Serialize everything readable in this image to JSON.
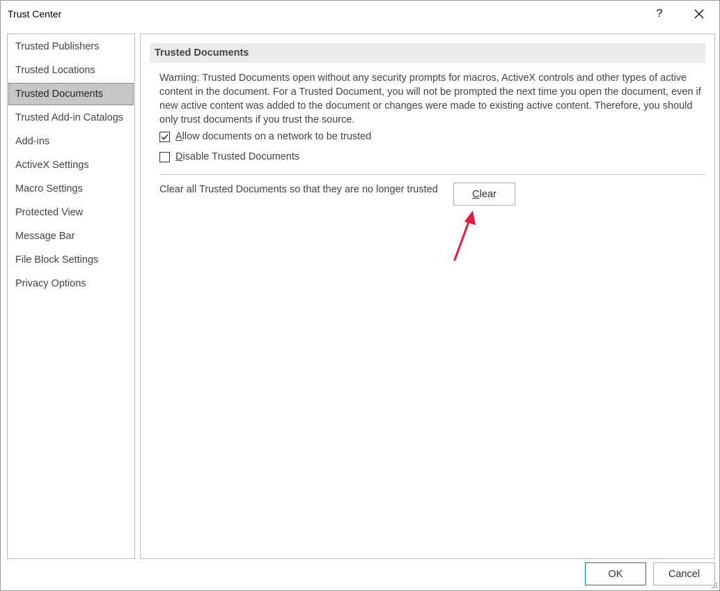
{
  "window": {
    "title": "Trust Center",
    "help_label": "?",
    "close_icon": "close-icon"
  },
  "sidebar": {
    "items": [
      {
        "label": "Trusted Publishers",
        "selected": false
      },
      {
        "label": "Trusted Locations",
        "selected": false
      },
      {
        "label": "Trusted Documents",
        "selected": true
      },
      {
        "label": "Trusted Add-in Catalogs",
        "selected": false
      },
      {
        "label": "Add-ins",
        "selected": false
      },
      {
        "label": "ActiveX Settings",
        "selected": false
      },
      {
        "label": "Macro Settings",
        "selected": false
      },
      {
        "label": "Protected View",
        "selected": false
      },
      {
        "label": "Message Bar",
        "selected": false
      },
      {
        "label": "File Block Settings",
        "selected": false
      },
      {
        "label": "Privacy Options",
        "selected": false
      }
    ]
  },
  "main": {
    "section_title": "Trusted Documents",
    "warning_text": "Warning: Trusted Documents open without any security prompts for macros, ActiveX controls and other types of active content in the document.  For a Trusted Document, you will not be prompted the next time you open the document, even if new active content was added to the document or changes were made to existing active content. Therefore, you should only trust documents if you trust the source.",
    "options": [
      {
        "accesskey": "A",
        "label_rest": "llow documents on a network to be trusted",
        "checked": true
      },
      {
        "accesskey": "D",
        "label_rest": "isable Trusted Documents",
        "checked": false
      }
    ],
    "clear_text": "Clear all Trusted Documents so that they are no longer trusted",
    "clear_button": {
      "accesskey": "C",
      "label_rest": "lear"
    }
  },
  "footer": {
    "ok_label": "OK",
    "cancel_label": "Cancel"
  },
  "colors": {
    "annotation_arrow": "#e8173f",
    "selected_item_bg": "#c6c6c6",
    "ok_border": "#0078d7"
  }
}
